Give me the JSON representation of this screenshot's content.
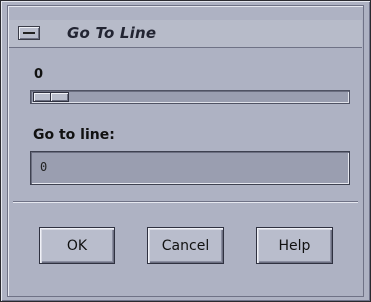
{
  "window": {
    "title": "Go To Line",
    "menu_icon": "window-menu-icon"
  },
  "scale": {
    "value_label": "0",
    "value": 0
  },
  "goto_field": {
    "label": "Go to line:",
    "value": "0"
  },
  "buttons": {
    "ok": "OK",
    "cancel": "Cancel",
    "help": "Help"
  }
}
